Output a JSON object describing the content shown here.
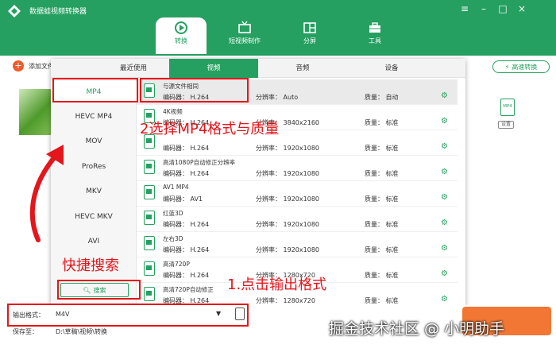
{
  "app": {
    "title": "数据蛙视频转换器"
  },
  "colors": {
    "brand": "#25a060",
    "accent": "#f27735",
    "annotation": "#e4151b"
  },
  "window_controls": [
    "menu-icon",
    "minimize-icon",
    "maximize-icon",
    "close-icon"
  ],
  "nav": {
    "tabs": [
      {
        "label": "转换",
        "icon": "convert-icon",
        "active": true
      },
      {
        "label": "短视频制作",
        "icon": "tv-icon",
        "active": false
      },
      {
        "label": "分屏",
        "icon": "split-screen-icon",
        "active": false
      },
      {
        "label": "工具",
        "icon": "toolbox-icon",
        "active": false
      }
    ]
  },
  "toolbar": {
    "add_file": "添加文件",
    "quick_convert": "高速转换"
  },
  "format_panel": {
    "tabs": [
      {
        "label": "最近使用",
        "active": false
      },
      {
        "label": "视频",
        "active": true
      },
      {
        "label": "音频",
        "active": false
      },
      {
        "label": "设备",
        "active": false
      }
    ],
    "categories": [
      {
        "label": "MP4",
        "selected": true
      },
      {
        "label": "HEVC MP4",
        "selected": false
      },
      {
        "label": "MOV",
        "selected": false
      },
      {
        "label": "ProRes",
        "selected": false
      },
      {
        "label": "MKV",
        "selected": false
      },
      {
        "label": "HEVC MKV",
        "selected": false
      },
      {
        "label": "AVI",
        "selected": false
      }
    ],
    "search_label": "搜索",
    "formats": [
      {
        "title": "与源文件相同",
        "codec": "编码器： H.264",
        "resolution": "分辨率： Auto",
        "quality": "质量： 自动"
      },
      {
        "title": "4K视频",
        "codec": "编码器： H.264",
        "resolution": "分辨率： 3840x2160",
        "quality": "质量： 标准"
      },
      {
        "title": "",
        "codec": "编码器： H.264",
        "resolution": "分辨率： 1920x1080",
        "quality": "质量： 标准"
      },
      {
        "title": "高清1080P自动修正分辨率",
        "codec": "编码器： H.264",
        "resolution": "分辨率： 1920x1080",
        "quality": "质量： 标准"
      },
      {
        "title": "AV1 MP4",
        "codec": "编码器： AV1",
        "resolution": "分辨率： 1920x1080",
        "quality": "质量： 标准"
      },
      {
        "title": "红蓝3D",
        "codec": "编码器： H.264",
        "resolution": "分辨率： 1920x1080",
        "quality": "质量： 标准"
      },
      {
        "title": "左右3D",
        "codec": "编码器： H.264",
        "resolution": "分辨率： 1920x1080",
        "quality": "质量： 标准"
      },
      {
        "title": "高清720P",
        "codec": "编码器： H.264",
        "resolution": "分辨率： 1280x720",
        "quality": "质量： 标准"
      },
      {
        "title": "高清720P自动修正",
        "codec": "编码器： H.264",
        "resolution": "分辨率： 1280x720",
        "quality": "质量： 标准"
      }
    ]
  },
  "bottom": {
    "output_label": "输出格式：",
    "output_value": "M4V",
    "save_label": "保存至：",
    "save_value": "D:\\草稿\\视频\\转换"
  },
  "right_panel": {
    "format_badge": "MP4",
    "settings_label": "设置"
  },
  "annotations": {
    "step1": "1.点击输出格式",
    "step2": "2选择MP4格式与质量",
    "quick_search": "快捷搜索"
  },
  "watermark": "掘金技术社区 @ 小明助手"
}
